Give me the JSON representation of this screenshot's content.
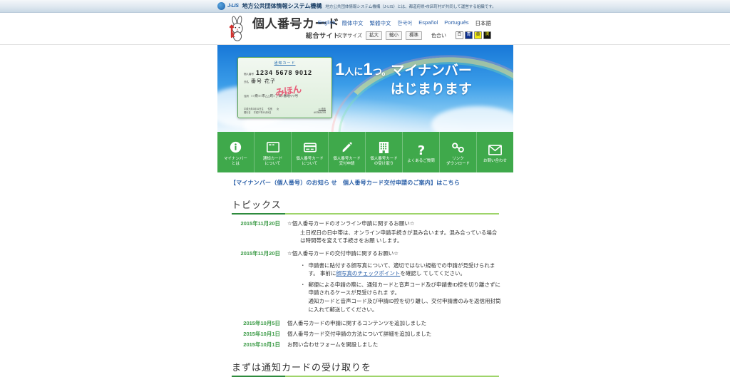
{
  "topbar": {
    "org_mark": "J-LIS",
    "org_name": "地方公共団体情報システム機構",
    "org_desc": "地方公共団体情報システム機構（J-LIS）とは、都道府県・市区町村が共同して運営する組織です。"
  },
  "header": {
    "brand_main": "個人番号カード",
    "brand_sub": "総合サイト",
    "mascot_name": "rabbit-mascot",
    "languages": [
      {
        "label": "English",
        "active": false
      },
      {
        "label": "簡体中文",
        "active": false
      },
      {
        "label": "繁體中文",
        "active": false
      },
      {
        "label": "한국어",
        "active": false
      },
      {
        "label": "Español",
        "active": false
      },
      {
        "label": "Português",
        "active": false
      },
      {
        "label": "日本語",
        "active": true
      }
    ],
    "textsize_label": "文字サイズ",
    "textsize_buttons": [
      "拡大",
      "縮小",
      "標準"
    ],
    "colorscheme_label": "色合い",
    "colorscheme_buttons": [
      {
        "name": "white",
        "glyph": "白",
        "bg": "#ffffff",
        "fg": "#333333"
      },
      {
        "name": "blue",
        "glyph": "青",
        "bg": "#0b2f8f",
        "fg": "#ffffff"
      },
      {
        "name": "yellow",
        "glyph": "黄",
        "bg": "#f5ec12",
        "fg": "#333333"
      },
      {
        "name": "black",
        "glyph": "黒",
        "bg": "#111111",
        "fg": "#f5ec12"
      }
    ]
  },
  "hero": {
    "headline_num1": "1",
    "headline_mid": "人に",
    "headline_num2": "1",
    "headline_tail": "つ。",
    "headline_brand": "マイナンバー",
    "headline_line2": "はじまります",
    "card": {
      "title": "通知カード",
      "number_label": "個人番号",
      "number": "1234 5678 9012",
      "name_label": "氏名",
      "name": "番号 花子",
      "stamp": "みほん",
      "address_label": "住所",
      "address": "○○県□□市△△町○丁目○番地▽▽号",
      "birth": "平成元年3月31日生",
      "sex_label": "性別",
      "sex": "女",
      "issue": "平成27年10月5日",
      "issue_label": "発行日",
      "issuer": "□□市長",
      "issuer_code": "AI23BACS9"
    }
  },
  "gnav": [
    {
      "icon": "info-circle-icon",
      "label": "マイナンバー\nとは"
    },
    {
      "icon": "window-card-icon",
      "label": "通知カード\nについて"
    },
    {
      "icon": "credit-card-icon",
      "label": "個人番号カード\nについて"
    },
    {
      "icon": "pencil-icon",
      "label": "個人番号カード\n交付申請"
    },
    {
      "icon": "building-icon",
      "label": "個人番号カード\nの受け取り"
    },
    {
      "icon": "question-mark-icon",
      "label": "よくあるご質問"
    },
    {
      "icon": "link-chain-icon",
      "label": "リンク\nダウンロード"
    },
    {
      "icon": "envelope-icon",
      "label": "お問い合わせ"
    }
  ],
  "notice": {
    "text": "【マイナンバー（個人番号）のお知ら せ　個人番号カード交付申請のご案内】はこちら"
  },
  "topics": {
    "title": "トピックス",
    "items": [
      {
        "date": "2015年11月20日",
        "heading": "☆個人番号カードのオンライン申請に関するお願い☆",
        "paragraph": "土日祝日の日中帯は、オンライン申請手続きが混み合います。混み合っている場合は時間帯を変えて手続きをお願 いします。",
        "bullets": []
      },
      {
        "date": "2015年11月20日",
        "heading": "☆個人番号カードの交付申請に関するお願い☆",
        "paragraph": "",
        "bullets": [
          {
            "pre": "申請書に貼付する顔写真について、適切ではない規格での申請が見受けられます。 事前に",
            "link": "顔写真のチェックポイント",
            "post": "を確認し てしてください。"
          },
          {
            "pre": "郵便による申請の際に、通知カードと音声コード及び申請書ID控を切り離さずに申請されるケースが見受けられま す。\n通知カードと音声コード及び申請ID控を切り離し、交付申請書のみを返信用封筒に入れて郵送してください。",
            "link": "",
            "post": ""
          }
        ]
      },
      {
        "date": "2015年10月5日",
        "heading": "個人番号カードの申請に関するコンテンツを追加しました",
        "paragraph": "",
        "bullets": []
      },
      {
        "date": "2015年10月1日",
        "heading": "個人番号カード交付申請の方法について詳細を追加しました",
        "paragraph": "",
        "bullets": []
      },
      {
        "date": "2015年10月1日",
        "heading": "お問い合わせフォームを開設しました",
        "paragraph": "",
        "bullets": []
      }
    ]
  },
  "next_section": {
    "title": "まずは通知カードの受け取りを"
  }
}
